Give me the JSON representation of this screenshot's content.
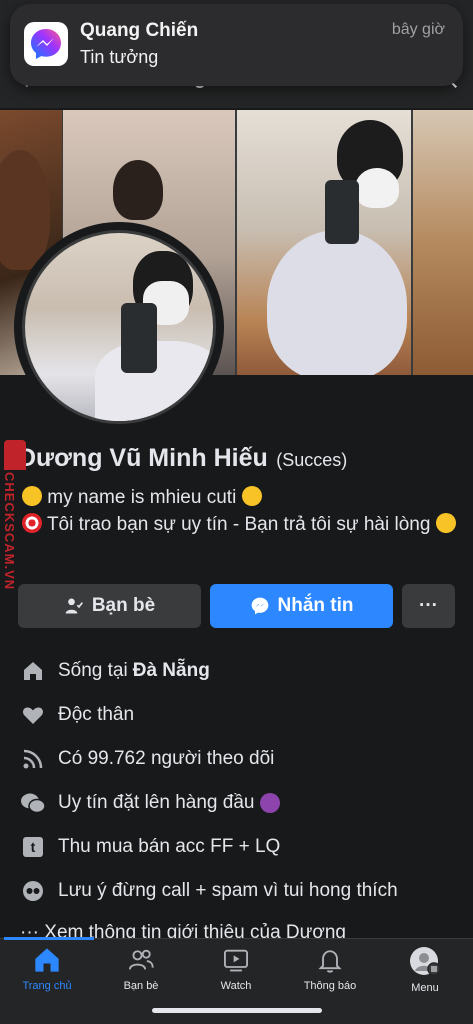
{
  "header": {
    "title": "Dương Vũ Minh Hiếu"
  },
  "notification": {
    "app": "messenger-icon",
    "title": "Quang Chiến",
    "body": "Tin tưởng",
    "time": "bây giờ"
  },
  "profile": {
    "name": "Dương Vũ Minh Hiếu",
    "nickname": "(Succes)",
    "bio_line1": "my name is mhieu cuti",
    "bio_line2": "Tôi trao bạn sự uy tín - Bạn trả tôi sự hài lòng"
  },
  "actions": {
    "friends_label": "Bạn bè",
    "message_label": "Nhắn tin",
    "more_label": "···"
  },
  "info": {
    "lives_prefix": "Sống tại",
    "lives_city": "Đà Nẵng",
    "relationship": "Độc thân",
    "followers": "Có 99.762 người theo dõi",
    "custom1": "Uy tín đặt lên hàng đầu",
    "custom2": "Thu mua bán acc FF + LQ",
    "custom3": "Lưu ý đừng call + spam vì tui hong thích",
    "see_about": "Xem thông tin giới thiệu của Dương"
  },
  "watermark": {
    "text": "CHECKSCAM.VN"
  },
  "tabs": [
    {
      "label": "Trang chủ",
      "icon": "home-icon",
      "active": true
    },
    {
      "label": "Bạn bè",
      "icon": "friends-icon",
      "active": false
    },
    {
      "label": "Watch",
      "icon": "watch-icon",
      "active": false
    },
    {
      "label": "Thông báo",
      "icon": "bell-icon",
      "active": false
    },
    {
      "label": "Menu",
      "icon": "menu-avatar-icon",
      "active": false
    }
  ],
  "colors": {
    "accent": "#2d88ff",
    "background": "#18191a",
    "button": "#3a3b3c"
  }
}
